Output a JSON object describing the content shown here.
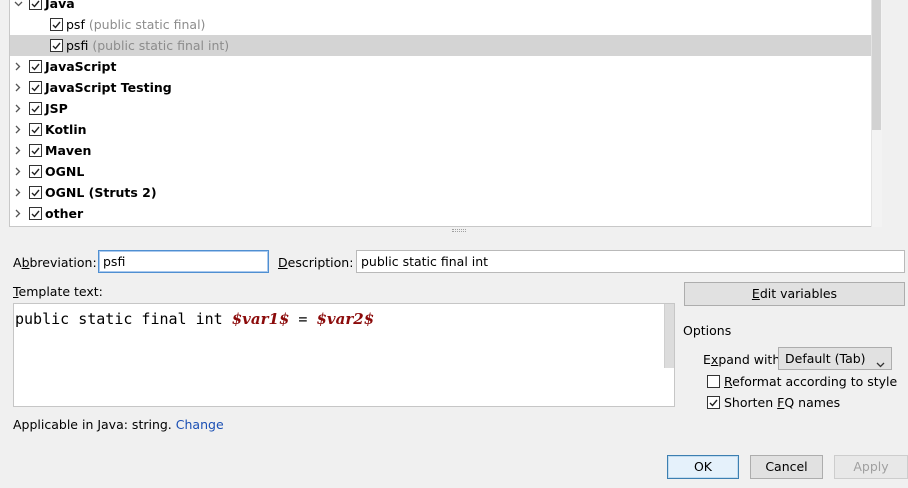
{
  "tree": {
    "java_group": {
      "label": "Java",
      "checked": true,
      "expanded": true
    },
    "templates": [
      {
        "name": "psf",
        "description": "(public static final)",
        "checked": true,
        "selected": false
      },
      {
        "name": "psfi",
        "description": "(public static final int)",
        "checked": true,
        "selected": true
      }
    ],
    "groups": [
      {
        "label": "JavaScript",
        "checked": true
      },
      {
        "label": "JavaScript Testing",
        "checked": true
      },
      {
        "label": "JSP",
        "checked": true
      },
      {
        "label": "Kotlin",
        "checked": true
      },
      {
        "label": "Maven",
        "checked": true
      },
      {
        "label": "OGNL",
        "checked": true
      },
      {
        "label": "OGNL (Struts 2)",
        "checked": true
      },
      {
        "label": "other",
        "checked": true
      }
    ]
  },
  "form": {
    "abbreviation_label_pre": "A",
    "abbreviation_label_ul": "b",
    "abbreviation_label_post": "breviation:",
    "abbreviation_value": "psfi",
    "description_label_ul": "D",
    "description_label_post": "escription:",
    "description_value": "public static final int",
    "template_text_label_ul": "T",
    "template_text_label_post": "emplate text:",
    "template_code_plain_1": "public static final int ",
    "template_var_1": "$var1$",
    "template_code_plain_2": " = ",
    "template_var_2": "$var2$",
    "applicable_text": "Applicable in Java: string.",
    "change_link": "Change"
  },
  "options": {
    "edit_variables_ul": "E",
    "edit_variables_post": "dit variables",
    "section_title": "Options",
    "expand_with_pre": "E",
    "expand_with_ul": "x",
    "expand_with_post": "pand with",
    "expand_with_value": "Default (Tab)",
    "reformat_ul": "R",
    "reformat_post": "eformat according to style",
    "reformat_checked": false,
    "shorten_pre": "Shorten ",
    "shorten_ul": "F",
    "shorten_post": "Q names",
    "shorten_checked": true
  },
  "buttons": {
    "ok": "OK",
    "cancel": "Cancel",
    "apply": "Apply"
  },
  "colors": {
    "selection": "#d4d4d4",
    "variable": "#8b0a0a",
    "link": "#1a4fb4",
    "focus": "#4f8fd1"
  }
}
